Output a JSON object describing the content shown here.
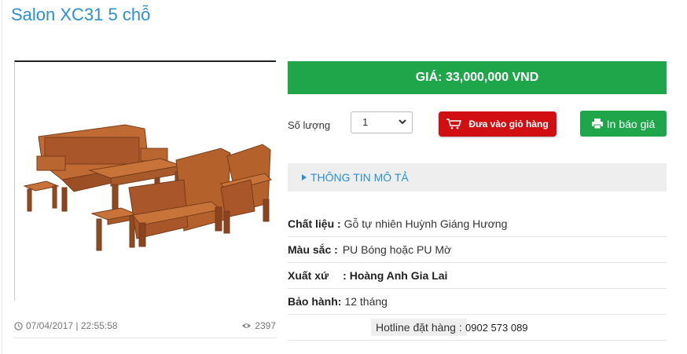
{
  "product": {
    "title": "Salon XC31 5 chỗ",
    "image_alt": "wooden-salon-sofa-set",
    "date": "07/04/2017 | 22:55:58",
    "views": "2397"
  },
  "purchase": {
    "price_text": "GIÁ: 33,000,000 VND",
    "quantity_label": "Số lượng",
    "quantity_value": "1",
    "add_to_cart_label": "Đưa vào giỏ hàng",
    "print_quote_label": "In báo giá"
  },
  "tabs": {
    "description_label": "THÔNG TIN MÔ TẢ"
  },
  "specs": [
    {
      "key": "Chất liệu :",
      "value": "Gỗ tự nhiên Huỳnh Giáng Hương"
    },
    {
      "key": "Màu sắc :",
      "value": "PU Bóng hoặc PU Mờ"
    },
    {
      "key": "Xuất xứ",
      "value": ": Hoàng Anh Gia Lai"
    },
    {
      "key": "Bảo hành:",
      "value": "12 tháng"
    }
  ],
  "hotline": {
    "label": "Hotline đặt hàng :",
    "number": "0902 573 089"
  },
  "colors": {
    "accent_blue": "#2a8fd0",
    "price_green": "#1fa64a",
    "cart_red": "#d10f12"
  },
  "icons": [
    "clock-icon",
    "eye-icon",
    "cart-icon",
    "printer-icon",
    "caret-right-icon",
    "chevron-down-icon"
  ]
}
